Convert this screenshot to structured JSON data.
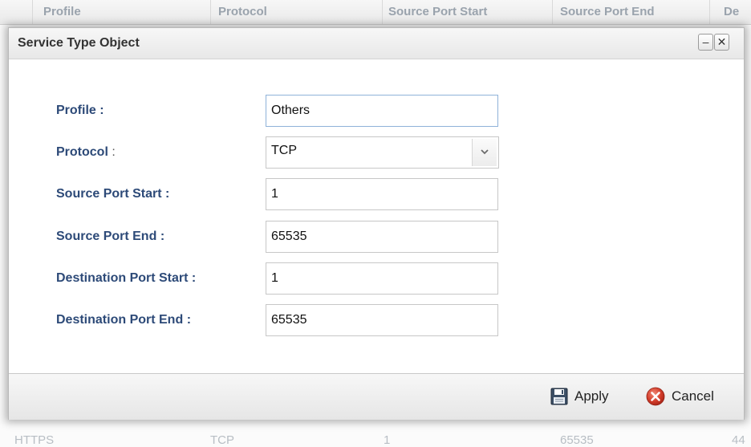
{
  "background_table": {
    "headers": [
      "Profile",
      "Protocol",
      "Source Port Start",
      "Source Port End",
      "De"
    ],
    "last_row": [
      "HTTPS",
      "TCP",
      "1",
      "65535",
      "44"
    ]
  },
  "dialog": {
    "title": "Service Type Object",
    "minimize_glyph": "–",
    "close_glyph": "✕"
  },
  "form": {
    "profile": {
      "label": "Profile",
      "colon": ":",
      "value": "Others"
    },
    "protocol": {
      "label": "Protocol",
      "colon": ":",
      "value": "TCP"
    },
    "source_port_start": {
      "label": "Source Port Start",
      "colon": ":",
      "value": "1"
    },
    "source_port_end": {
      "label": "Source Port End",
      "colon": ":",
      "value": "65535"
    },
    "destination_port_start": {
      "label": "Destination Port Start",
      "colon": ":",
      "value": "1"
    },
    "destination_port_end": {
      "label": "Destination Port End",
      "colon": ":",
      "value": "65535"
    }
  },
  "footer": {
    "apply_label": "Apply",
    "cancel_label": "Cancel",
    "apply_icon": "save-icon",
    "cancel_icon": "cancel-icon"
  },
  "colors": {
    "label": "#2d4a78",
    "cancel_icon": "#d23c2a",
    "focus_border": "#8fb2d9"
  }
}
